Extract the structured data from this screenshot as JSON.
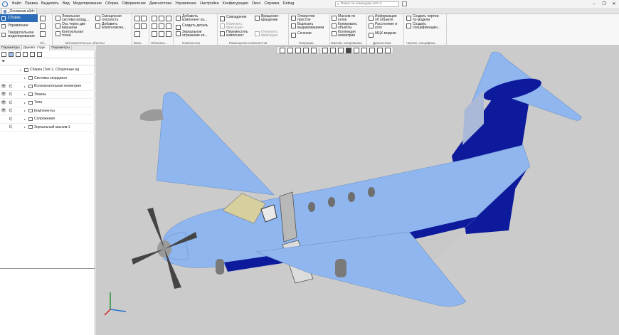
{
  "menu": {
    "items": [
      "Файл",
      "Правка",
      "Выделить",
      "Вид",
      "Моделирование",
      "Сборка",
      "Оформление",
      "Диагностика",
      "Управление",
      "Настройка",
      "Конфигурация",
      "Окно",
      "Справка",
      "Debug"
    ],
    "search_placeholder": "Поиск по командам (Alt+/)"
  },
  "document_tab": {
    "label": "_Основная.a3d"
  },
  "modes": [
    "Сборка",
    "Управление",
    "Твердотельное\nмоделирование"
  ],
  "ribbon": {
    "groups": {
      "g1": "Сб...",
      "g2": "Вспомогательные объекты",
      "g3": "Ваза...",
      "g4": "Обозначе...",
      "g5": "Компоненты",
      "g6": "Размещение компонентов",
      "g7": "Операции",
      "g8": "Массив, копирование",
      "g9": "Диагностика",
      "g10": "Чертеж, специфика..."
    },
    "buttons": {
      "local_cs": "Локальная\nсистема коорд...",
      "axis_two_vertices": "Ось через две\nвершины",
      "control_point": "Контрольная\nточка",
      "offset_plane": "Смещенная\nплоскость",
      "add_component_group": "Добавить\nкомпоновочн...",
      "add_component_file": "Добавить\nкомпонент из...",
      "create_part": "Создать деталь",
      "mirror_component": "Зеркальное\nотражение ко...",
      "coincidence": "Совпадение",
      "move_component": "Переместить\nкомпонент",
      "rotation_rotation": "Вращение-\nвращение",
      "transform_disabled": "Изменить\nфиксацию",
      "fix_disabled": "Отменить\nфиксацию",
      "hole_simple": "Отверстие\nпростое",
      "cut_extrude": "Вырезать\nвыдавливанием",
      "section": "Сечение",
      "mesh_array": "Массив по\nсетке",
      "copy_objects": "Копировать\nобъекты",
      "geometry_collection": "Коллекция\nгеометрии",
      "object_info": "Информация\nоб объекте",
      "distance_angle": "Расстояние и\nугол",
      "mass_properties": "МЦХ модели",
      "create_drawing": "Создать чертеж\nпо модели",
      "create_specification": "Создать\nспецификацию..."
    }
  },
  "panel": {
    "tabs": [
      "Параметры",
      "Дерево: струк...",
      "Параметры"
    ],
    "tree": [
      {
        "label": "Сборка (Тел-1, Сборочные ед",
        "eye": "",
        "eps": "",
        "level": 0
      },
      {
        "label": "Системы координат",
        "eye": "",
        "eps": "",
        "level": 1
      },
      {
        "label": "Вспомогательная геометрия",
        "eye": "👁",
        "eps": "∈",
        "level": 1
      },
      {
        "label": "Эскизы",
        "eye": "👁",
        "eps": "∈",
        "level": 1
      },
      {
        "label": "Тела",
        "eye": "👁",
        "eps": "∈",
        "level": 1
      },
      {
        "label": "Компоненты",
        "eye": "👁",
        "eps": "∈",
        "level": 1
      },
      {
        "label": "Сопряжения",
        "eye": "",
        "eps": "∈",
        "level": 1
      },
      {
        "label": "Зеркальный массив:1",
        "eye": "",
        "eps": "∈",
        "level": 1
      }
    ]
  },
  "colors": {
    "ribbon_active": "#2c6cb8",
    "viewport_bg": "#cbcbcb",
    "fuselage_light": "#8fb6ef",
    "fuselage_dark": "#0d1a9c",
    "belly_gray": "#c8c8c8"
  },
  "icons": [
    "app-logo-icon",
    "search-icon",
    "eye-icon",
    "epsilon-icon",
    "filter-icon",
    "coordinate-triad-icon"
  ]
}
